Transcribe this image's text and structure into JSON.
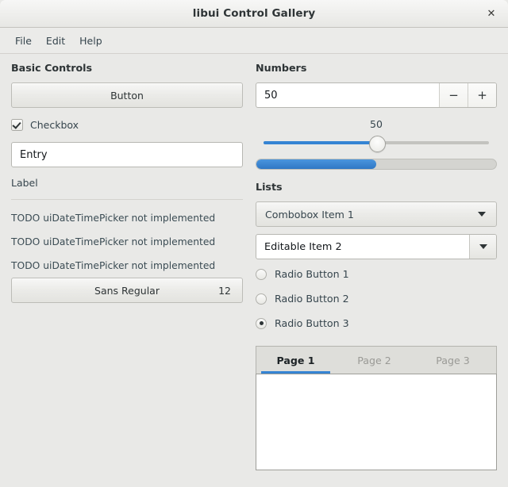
{
  "window": {
    "title": "libui Control Gallery",
    "close_icon": "close-icon"
  },
  "menubar": {
    "items": [
      {
        "label": "File"
      },
      {
        "label": "Edit"
      },
      {
        "label": "Help"
      }
    ]
  },
  "basic_controls": {
    "title": "Basic Controls",
    "button_label": "Button",
    "checkbox": {
      "label": "Checkbox",
      "checked": true
    },
    "entry_value": "Entry",
    "entry_placeholder": "",
    "label_text": "Label",
    "todo_items": [
      "TODO uiDateTimePicker not implemented",
      "TODO uiDateTimePicker not implemented",
      "TODO uiDateTimePicker not implemented"
    ],
    "font_button": {
      "family": "Sans Regular",
      "size": "12"
    }
  },
  "numbers": {
    "title": "Numbers",
    "spinbox": {
      "value": "50",
      "decrement_icon": "minus-icon",
      "decrement_label": "−",
      "increment_icon": "plus-icon",
      "increment_label": "+"
    },
    "slider": {
      "value": "50",
      "percent": 50,
      "min": 0,
      "max": 100
    },
    "progressbar": {
      "percent": 50
    },
    "accent_color": "#3584d3"
  },
  "lists": {
    "title": "Lists",
    "combobox": {
      "value": "Combobox Item 1",
      "arrow_icon": "chevron-down-icon"
    },
    "editable_combobox": {
      "value": "Editable Item 2",
      "arrow_icon": "chevron-down-icon"
    },
    "radios": [
      {
        "label": "Radio Button 1",
        "selected": false
      },
      {
        "label": "Radio Button 2",
        "selected": false
      },
      {
        "label": "Radio Button 3",
        "selected": true
      }
    ]
  },
  "tabs": {
    "items": [
      {
        "label": "Page 1",
        "active": true
      },
      {
        "label": "Page 2",
        "active": false
      },
      {
        "label": "Page 3",
        "active": false
      }
    ]
  }
}
